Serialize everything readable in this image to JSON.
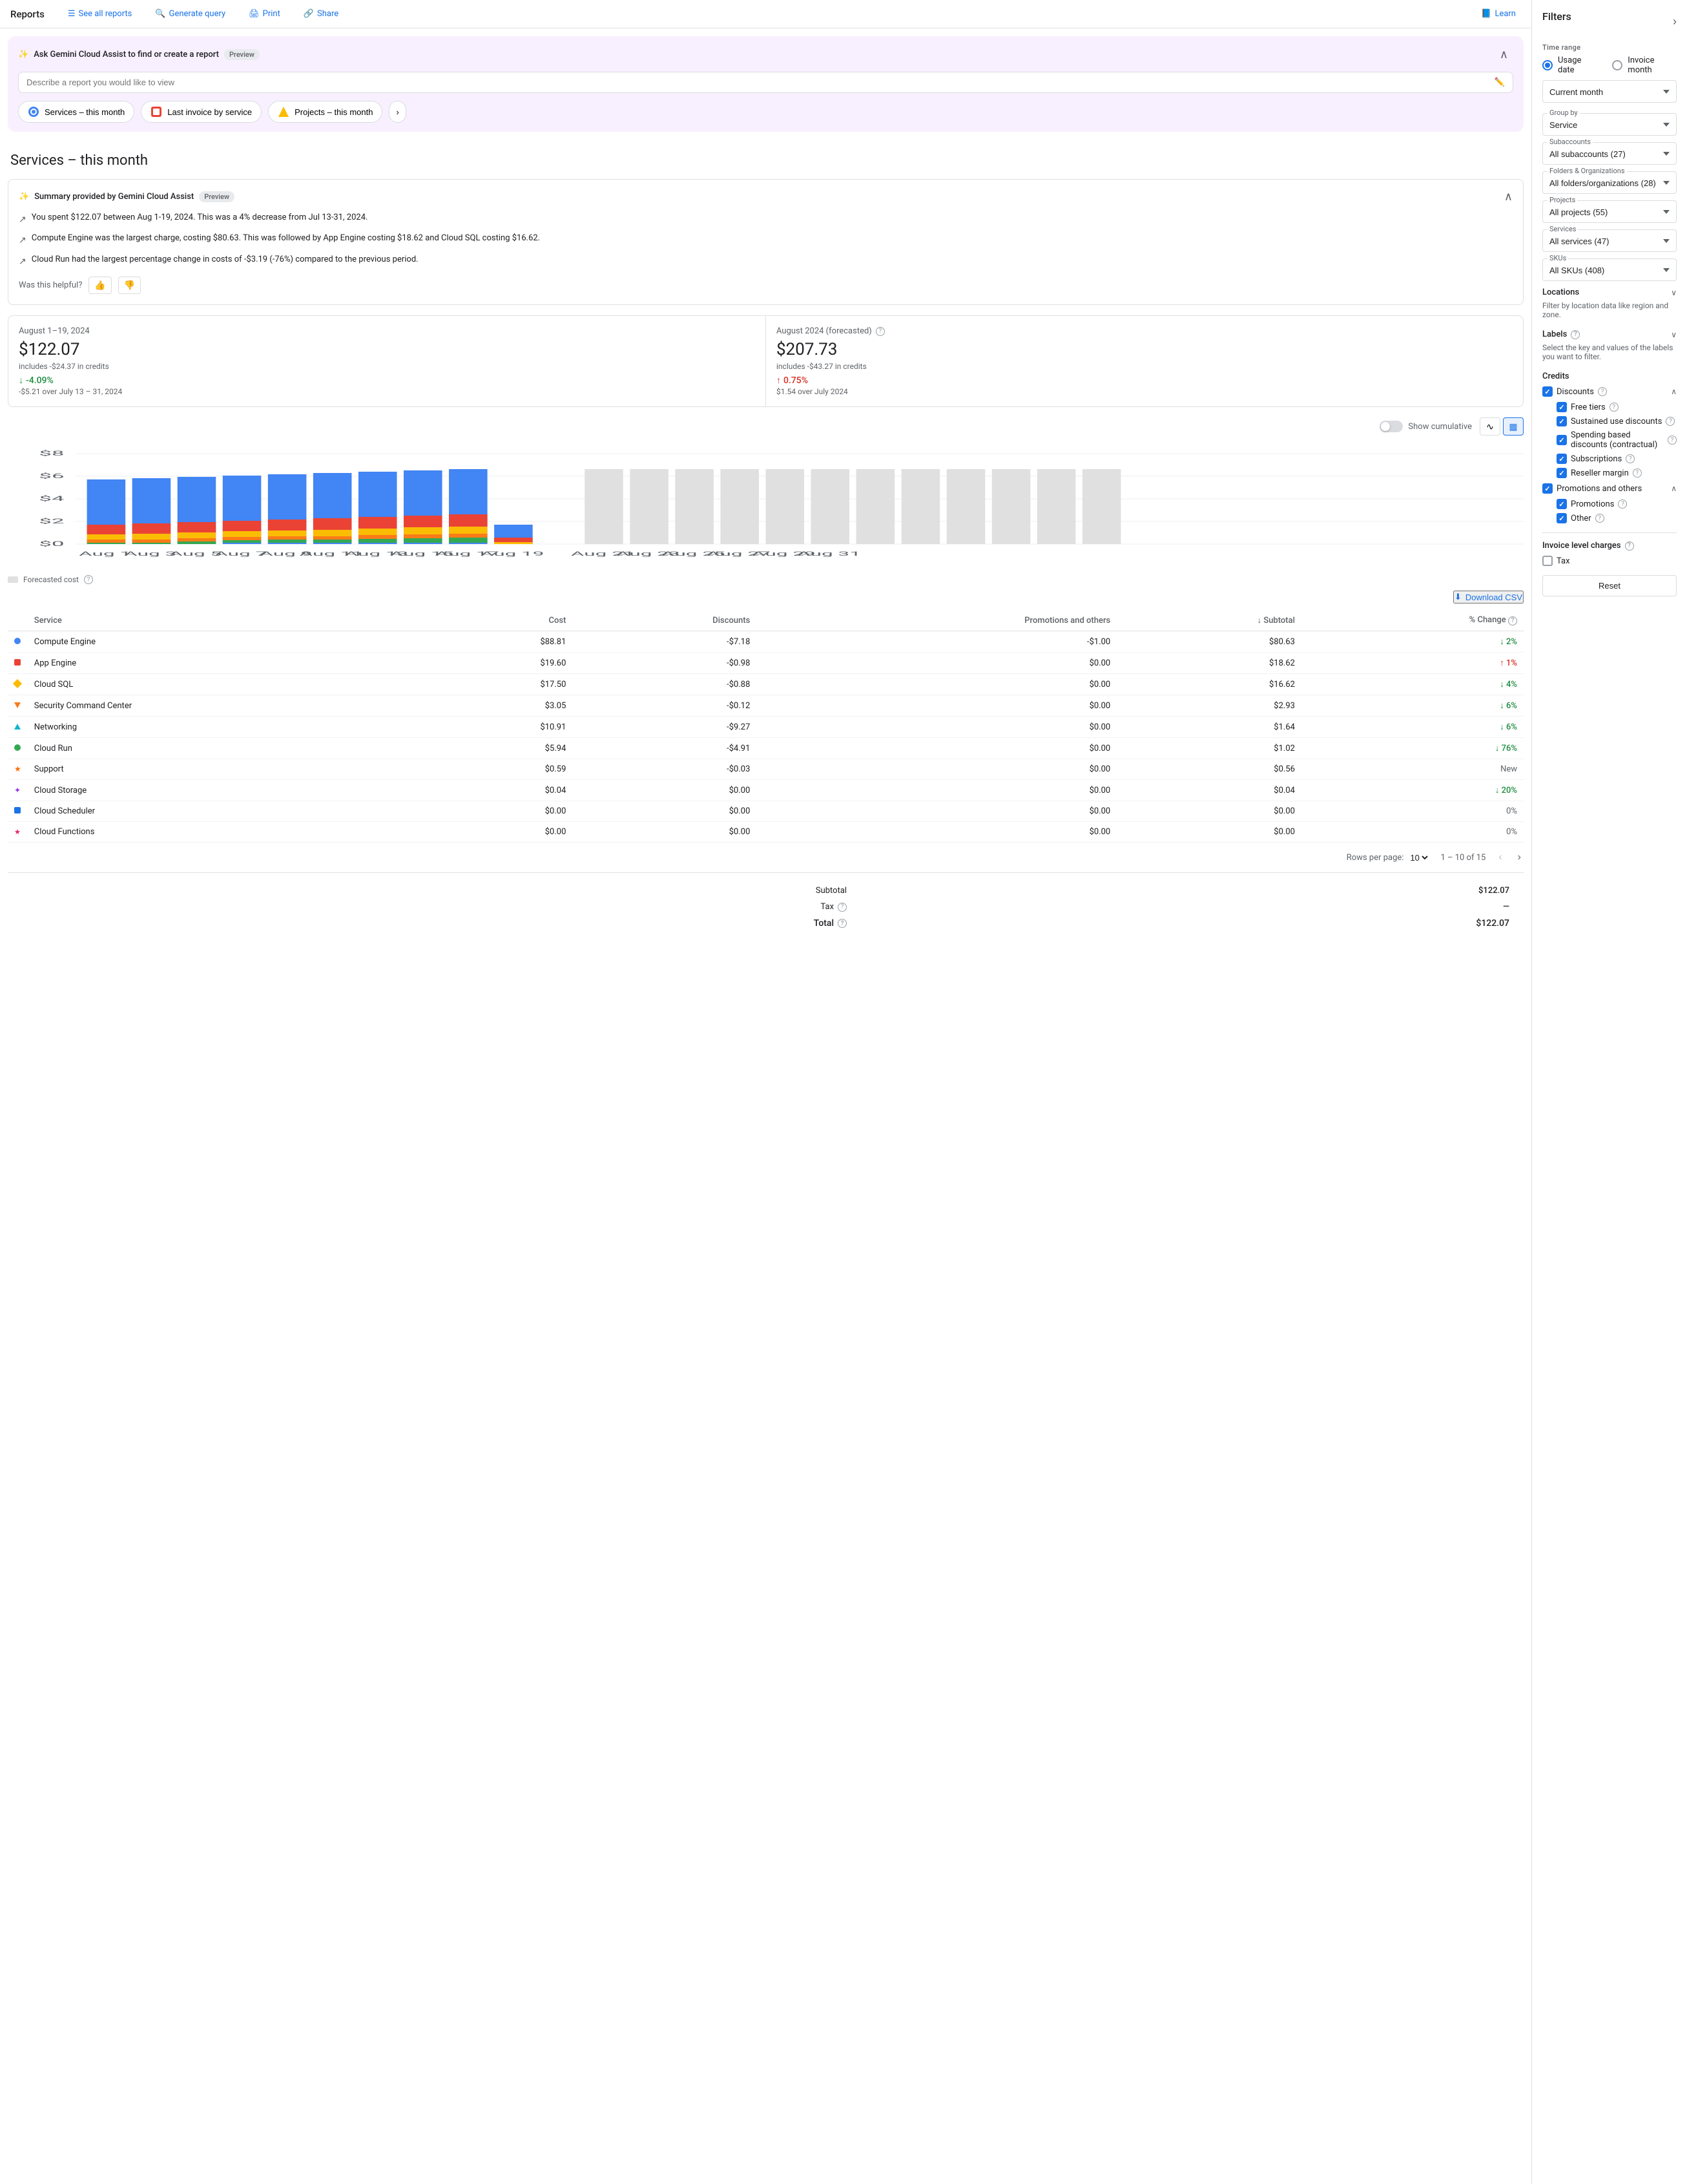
{
  "topnav": {
    "title": "Reports",
    "see_all_reports": "See all reports",
    "generate_query": "Generate query",
    "print": "Print",
    "share": "Share",
    "learn": "Learn"
  },
  "gemini": {
    "title": "Ask Gemini Cloud Assist to find or create a report",
    "preview_badge": "Preview",
    "input_placeholder": "Describe a report you would like to view",
    "quick_reports": [
      {
        "label": "Services – this month"
      },
      {
        "label": "Last invoice by service"
      },
      {
        "label": "Projects – this month"
      }
    ]
  },
  "page_title": "Services – this month",
  "summary": {
    "title": "Summary provided by Gemini Cloud Assist",
    "preview_badge": "Preview",
    "lines": [
      "You spent $122.07 between Aug 1-19, 2024. This was a 4% decrease from Jul 13-31, 2024.",
      "Compute Engine was the largest charge, costing $80.63. This was followed by App Engine costing $18.62 and Cloud SQL costing $16.62.",
      "Cloud Run had the largest percentage change in costs of -$3.19 (-76%) compared to the previous period."
    ],
    "helpful_label": "Was this helpful?"
  },
  "metric_current": {
    "period": "August 1–19, 2024",
    "amount": "$122.07",
    "credits": "includes -$24.37 in credits",
    "change_pct": "-4.09%",
    "change_dir": "down",
    "change_sub": "-$5.21 over July 13 – 31, 2024"
  },
  "metric_forecast": {
    "period": "August 2024 (forecasted)",
    "amount": "$207.73",
    "credits": "includes -$43.27 in credits",
    "change_pct": "0.75%",
    "change_dir": "up",
    "change_sub": "$1.54 over July 2024"
  },
  "chart": {
    "y_labels": [
      "$8",
      "$6",
      "$4",
      "$2",
      "$0"
    ],
    "x_labels": [
      "Aug 1",
      "Aug 3",
      "Aug 5",
      "Aug 7",
      "Aug 9",
      "Aug 11",
      "Aug 13",
      "Aug 15",
      "Aug 17",
      "Aug 19",
      "Aug 21",
      "Aug 23",
      "Aug 25",
      "Aug 27",
      "Aug 29",
      "Aug 31"
    ],
    "cumulative_label": "Show cumulative",
    "forecast_legend": "Forecasted cost",
    "download_csv": "Download CSV"
  },
  "table": {
    "headers": [
      "Service",
      "Cost",
      "Discounts",
      "Promotions and others",
      "Subtotal",
      "% Change"
    ],
    "rows": [
      {
        "service": "Compute Engine",
        "color": "#4285f4",
        "shape": "circle",
        "cost": "$88.81",
        "discounts": "-$7.18",
        "promotions": "-$1.00",
        "subtotal": "$80.63",
        "change": "2%",
        "change_dir": "down"
      },
      {
        "service": "App Engine",
        "color": "#ea4335",
        "shape": "square",
        "cost": "$19.60",
        "discounts": "-$0.98",
        "promotions": "$0.00",
        "subtotal": "$18.62",
        "change": "1%",
        "change_dir": "up"
      },
      {
        "service": "Cloud SQL",
        "color": "#fbbc04",
        "shape": "diamond",
        "cost": "$17.50",
        "discounts": "-$0.88",
        "promotions": "$0.00",
        "subtotal": "$16.62",
        "change": "4%",
        "change_dir": "down"
      },
      {
        "service": "Security Command Center",
        "color": "#fa7b17",
        "shape": "triangle-down",
        "cost": "$3.05",
        "discounts": "-$0.12",
        "promotions": "$0.00",
        "subtotal": "$2.93",
        "change": "6%",
        "change_dir": "down"
      },
      {
        "service": "Networking",
        "color": "#12b5cb",
        "shape": "triangle-up",
        "cost": "$10.91",
        "discounts": "-$9.27",
        "promotions": "$0.00",
        "subtotal": "$1.64",
        "change": "6%",
        "change_dir": "down"
      },
      {
        "service": "Cloud Run",
        "color": "#34a853",
        "shape": "circle",
        "cost": "$5.94",
        "discounts": "-$4.91",
        "promotions": "$0.00",
        "subtotal": "$1.02",
        "change": "76%",
        "change_dir": "down"
      },
      {
        "service": "Support",
        "color": "#ff6d00",
        "shape": "star",
        "cost": "$0.59",
        "discounts": "-$0.03",
        "promotions": "$0.00",
        "subtotal": "$0.56",
        "change": "New",
        "change_dir": "neutral"
      },
      {
        "service": "Cloud Storage",
        "color": "#9334e6",
        "shape": "star4",
        "cost": "$0.04",
        "discounts": "$0.00",
        "promotions": "$0.00",
        "subtotal": "$0.04",
        "change": "20%",
        "change_dir": "down"
      },
      {
        "service": "Cloud Scheduler",
        "color": "#1a73e8",
        "shape": "square",
        "cost": "$0.00",
        "discounts": "$0.00",
        "promotions": "$0.00",
        "subtotal": "$0.00",
        "change": "0%",
        "change_dir": "neutral"
      },
      {
        "service": "Cloud Functions",
        "color": "#e91e63",
        "shape": "star5",
        "cost": "$0.00",
        "discounts": "$0.00",
        "promotions": "$0.00",
        "subtotal": "$0.00",
        "change": "0%",
        "change_dir": "neutral"
      }
    ],
    "pagination": {
      "rows_per_page_label": "Rows per page:",
      "rows_per_page": "10",
      "page_info": "1 – 10 of 15"
    }
  },
  "totals": {
    "subtotal_label": "Subtotal",
    "subtotal_value": "$122.07",
    "tax_label": "Tax",
    "tax_value": "—",
    "total_label": "Total",
    "total_value": "$122.07"
  },
  "filters": {
    "title": "Filters",
    "time_range_label": "Time range",
    "usage_date_label": "Usage date",
    "invoice_month_label": "Invoice month",
    "current_month_label": "Current month",
    "group_by_label": "Group by",
    "group_by_value": "Service",
    "subaccounts_label": "Subaccounts",
    "subaccounts_value": "All subaccounts (27)",
    "folders_label": "Folders & Organizations",
    "folders_value": "All folders/organizations (28)",
    "projects_label": "Projects",
    "projects_value": "All projects (55)",
    "services_label": "Services",
    "services_value": "All services (47)",
    "skus_label": "SKUs",
    "skus_value": "All SKUs (408)",
    "locations_label": "Locations",
    "locations_sub": "Filter by location data like region and zone.",
    "labels_label": "Labels",
    "labels_sub": "Select the key and values of the labels you want to filter.",
    "credits_label": "Credits",
    "discounts_label": "Discounts",
    "free_tiers_label": "Free tiers",
    "sustained_label": "Sustained use discounts",
    "spending_label": "Spending based discounts (contractual)",
    "subscriptions_label": "Subscriptions",
    "reseller_label": "Reseller margin",
    "promotions_others_label": "Promotions and others",
    "promotions_label": "Promotions",
    "other_label": "Other",
    "invoice_charges_label": "Invoice level charges",
    "tax_label": "Tax",
    "reset_label": "Reset"
  }
}
